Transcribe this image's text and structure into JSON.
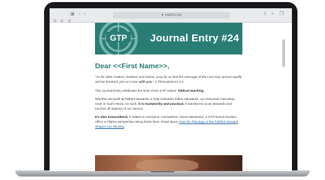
{
  "browser": {
    "url": "mailchi.mp"
  },
  "email": {
    "banner_title": "Journal Entry #24",
    "logo_text": "GTP",
    "greeting": "Dear <<First Name>>,",
    "quote_part1": "“As for other matters, brothers and sisters, pray for us that the message of the Lord may spread rapidly and be honored, just as it was ",
    "quote_bold": "with you",
    "quote_part2": ".” 2 Thessalonians 3:1",
    "p1_text": "This Journal Entry celebrates the sixth of ten GTP values: ",
    "p1_bold": "biblical teaching.",
    "p2_text1": "Whether we build up faithful stewards or help ministries follow standards, our instruction has deep roots in God’s Word. As such, ",
    "p2_bold": "it is trustworthy and practical.",
    "p2_text2": " It transforms us as stewards and touches all aspects of our service.",
    "p3_bold": "It’s also transcultural.",
    "p3_text": " It relates to everyone, everywhere. Zenet Maramara, a GTP board member, offers a Filipino perspective along these lines. Read about ",
    "p3_link": "How the Theology of the Faithful Steward Shapes Our Ministry",
    "p3_end": "."
  },
  "colors": {
    "brand_teal": "#2a7d75",
    "link_blue": "#1f5f9a"
  },
  "icons": [
    "sidebar-icon",
    "back-icon",
    "forward-icon",
    "lock-icon",
    "share-icon",
    "new-tab-icon",
    "tabs-icon"
  ]
}
